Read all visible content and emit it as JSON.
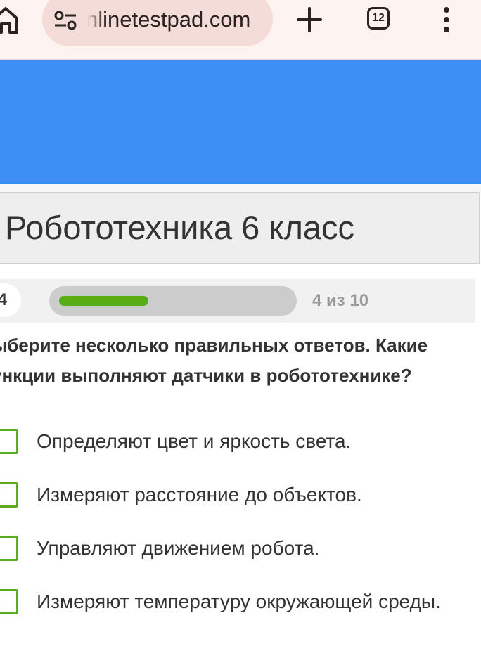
{
  "browser": {
    "url": "nlinetestpad.com",
    "tab_count": "12",
    "icons": {
      "home": "home-icon",
      "site_info": "tune-icon",
      "new_tab": "plus-icon",
      "menu": "more-vert-icon"
    }
  },
  "test": {
    "title": "Робототехника 6 класс"
  },
  "progress": {
    "question_number": "4",
    "current": 4,
    "total": 10,
    "text": "4 из 10",
    "fill_color": "#58ad14"
  },
  "question": {
    "line1": "ыберите несколько правильных ответов. Какие",
    "line2": "ункции выполняют датчики в робототехнике?"
  },
  "answers": [
    {
      "label": "Определяют цвет и яркость света.",
      "checked": false
    },
    {
      "label": "Измеряют расстояние до объектов.",
      "checked": false
    },
    {
      "label": "Управляют движением робота.",
      "checked": false
    },
    {
      "label": "Измеряют температуру окружающей среды.",
      "checked": false
    }
  ],
  "colors": {
    "banner": "#3d8ff6",
    "checkbox_border": "#5aab1d",
    "chrome_bg": "#fdf3f1"
  }
}
